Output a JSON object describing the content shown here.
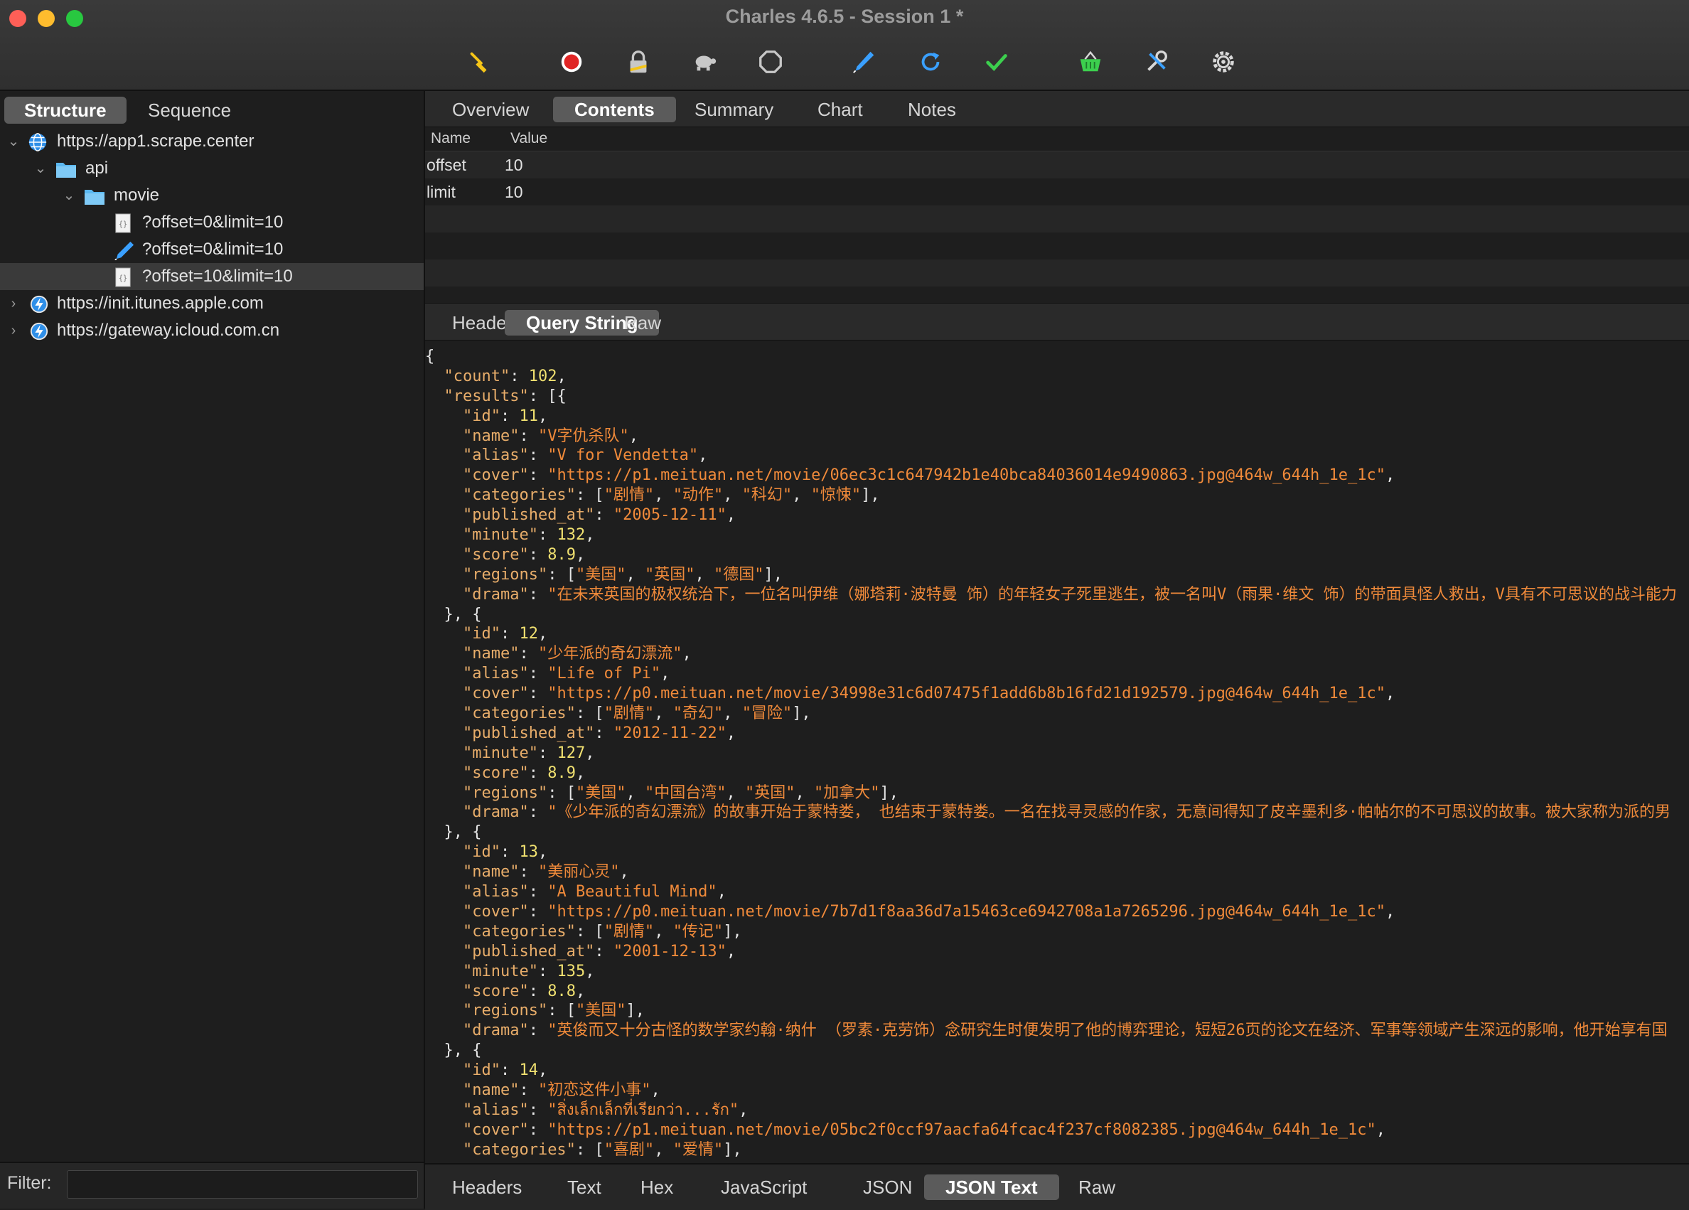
{
  "window": {
    "title": "Charles 4.6.5 - Session 1 *"
  },
  "toolbar": {
    "icons": [
      "broom-icon",
      "record-icon",
      "ssl-lock-icon",
      "throttle-turtle-icon",
      "stop-breakpoints-icon",
      "compose-pen-icon",
      "repeat-icon",
      "validate-check-icon",
      "basket-icon",
      "tools-icon",
      "settings-gear-icon"
    ],
    "colors": {
      "broom": "#f5c518",
      "record": "#e02424",
      "lock": "#c8c8c8",
      "turtle": "#c8c8c8",
      "stop": "#c8c8c8",
      "pen": "#3aa0ff",
      "repeat": "#3aa0ff",
      "check": "#3ccf4e",
      "basket": "#3ccf4e",
      "tools": "#d8d8d8",
      "gear": "#d8d8d8"
    }
  },
  "left": {
    "segments": [
      {
        "label": "Structure",
        "active": true
      },
      {
        "label": "Sequence",
        "active": false
      }
    ],
    "tree": [
      {
        "label": "https://app1.scrape.center",
        "depth": 0,
        "chevron": "down",
        "icon": "globe-icon"
      },
      {
        "label": "api",
        "depth": 1,
        "chevron": "down",
        "icon": "folder-icon"
      },
      {
        "label": "movie",
        "depth": 2,
        "chevron": "down",
        "icon": "folder-icon"
      },
      {
        "label": "?offset=0&limit=10",
        "depth": 3,
        "chevron": "",
        "icon": "json-file-icon"
      },
      {
        "label": "?offset=0&limit=10",
        "depth": 3,
        "chevron": "",
        "icon": "pen-icon"
      },
      {
        "label": "?offset=10&limit=10",
        "depth": 3,
        "chevron": "",
        "icon": "json-file-icon",
        "selected": true
      },
      {
        "label": "https://init.itunes.apple.com",
        "depth": 0,
        "chevron": "right",
        "icon": "lightning-icon"
      },
      {
        "label": "https://gateway.icloud.com.cn",
        "depth": 0,
        "chevron": "right",
        "icon": "lightning-icon"
      }
    ],
    "filter": {
      "label": "Filter:",
      "value": ""
    }
  },
  "top_tabs": [
    {
      "label": "Overview",
      "active": false
    },
    {
      "label": "Contents",
      "active": true
    },
    {
      "label": "Summary",
      "active": false
    },
    {
      "label": "Chart",
      "active": false
    },
    {
      "label": "Notes",
      "active": false
    }
  ],
  "query_table": {
    "headers": [
      "Name",
      "Value"
    ],
    "rows": [
      [
        "offset",
        "10"
      ],
      [
        "limit",
        "10"
      ],
      [
        "",
        ""
      ],
      [
        "",
        ""
      ],
      [
        "",
        ""
      ]
    ]
  },
  "request_tabs": [
    {
      "label": "Headers",
      "active": false
    },
    {
      "label": "Query String",
      "active": true
    },
    {
      "label": "Raw",
      "active": false
    }
  ],
  "json_lines": [
    [
      [
        "p",
        "{"
      ]
    ],
    [
      [
        "p",
        "  "
      ],
      [
        "k",
        "\"count\""
      ],
      [
        "p",
        ": "
      ],
      [
        "n",
        "102"
      ],
      [
        "p",
        ","
      ]
    ],
    [
      [
        "p",
        "  "
      ],
      [
        "k",
        "\"results\""
      ],
      [
        "p",
        ": [{"
      ]
    ],
    [
      [
        "p",
        "    "
      ],
      [
        "k",
        "\"id\""
      ],
      [
        "p",
        ": "
      ],
      [
        "n",
        "11"
      ],
      [
        "p",
        ","
      ]
    ],
    [
      [
        "p",
        "    "
      ],
      [
        "k",
        "\"name\""
      ],
      [
        "p",
        ": "
      ],
      [
        "s",
        "\"V字仇杀队\""
      ],
      [
        "p",
        ","
      ]
    ],
    [
      [
        "p",
        "    "
      ],
      [
        "k",
        "\"alias\""
      ],
      [
        "p",
        ": "
      ],
      [
        "s",
        "\"V for Vendetta\""
      ],
      [
        "p",
        ","
      ]
    ],
    [
      [
        "p",
        "    "
      ],
      [
        "k",
        "\"cover\""
      ],
      [
        "p",
        ": "
      ],
      [
        "s",
        "\"https://p1.meituan.net/movie/06ec3c1c647942b1e40bca84036014e9490863.jpg@464w_644h_1e_1c\""
      ],
      [
        "p",
        ","
      ]
    ],
    [
      [
        "p",
        "    "
      ],
      [
        "k",
        "\"categories\""
      ],
      [
        "p",
        ": ["
      ],
      [
        "s",
        "\"剧情\""
      ],
      [
        "p",
        ", "
      ],
      [
        "s",
        "\"动作\""
      ],
      [
        "p",
        ", "
      ],
      [
        "s",
        "\"科幻\""
      ],
      [
        "p",
        ", "
      ],
      [
        "s",
        "\"惊悚\""
      ],
      [
        "p",
        "],"
      ]
    ],
    [
      [
        "p",
        "    "
      ],
      [
        "k",
        "\"published_at\""
      ],
      [
        "p",
        ": "
      ],
      [
        "s",
        "\"2005-12-11\""
      ],
      [
        "p",
        ","
      ]
    ],
    [
      [
        "p",
        "    "
      ],
      [
        "k",
        "\"minute\""
      ],
      [
        "p",
        ": "
      ],
      [
        "n",
        "132"
      ],
      [
        "p",
        ","
      ]
    ],
    [
      [
        "p",
        "    "
      ],
      [
        "k",
        "\"score\""
      ],
      [
        "p",
        ": "
      ],
      [
        "n",
        "8.9"
      ],
      [
        "p",
        ","
      ]
    ],
    [
      [
        "p",
        "    "
      ],
      [
        "k",
        "\"regions\""
      ],
      [
        "p",
        ": ["
      ],
      [
        "s",
        "\"美国\""
      ],
      [
        "p",
        ", "
      ],
      [
        "s",
        "\"英国\""
      ],
      [
        "p",
        ", "
      ],
      [
        "s",
        "\"德国\""
      ],
      [
        "p",
        "],"
      ]
    ],
    [
      [
        "p",
        "    "
      ],
      [
        "k",
        "\"drama\""
      ],
      [
        "p",
        ": "
      ],
      [
        "s",
        "\"在未来英国的极权统治下，一位名叫伊维（娜塔莉·波特曼 饰）的年轻女子死里逃生，被一名叫V（雨果·维文 饰）的带面具怪人救出，V具有不可思议的战斗能力"
      ]
    ],
    [
      [
        "p",
        "  }, {"
      ]
    ],
    [
      [
        "p",
        "    "
      ],
      [
        "k",
        "\"id\""
      ],
      [
        "p",
        ": "
      ],
      [
        "n",
        "12"
      ],
      [
        "p",
        ","
      ]
    ],
    [
      [
        "p",
        "    "
      ],
      [
        "k",
        "\"name\""
      ],
      [
        "p",
        ": "
      ],
      [
        "s",
        "\"少年派的奇幻漂流\""
      ],
      [
        "p",
        ","
      ]
    ],
    [
      [
        "p",
        "    "
      ],
      [
        "k",
        "\"alias\""
      ],
      [
        "p",
        ": "
      ],
      [
        "s",
        "\"Life of Pi\""
      ],
      [
        "p",
        ","
      ]
    ],
    [
      [
        "p",
        "    "
      ],
      [
        "k",
        "\"cover\""
      ],
      [
        "p",
        ": "
      ],
      [
        "s",
        "\"https://p0.meituan.net/movie/34998e31c6d07475f1add6b8b16fd21d192579.jpg@464w_644h_1e_1c\""
      ],
      [
        "p",
        ","
      ]
    ],
    [
      [
        "p",
        "    "
      ],
      [
        "k",
        "\"categories\""
      ],
      [
        "p",
        ": ["
      ],
      [
        "s",
        "\"剧情\""
      ],
      [
        "p",
        ", "
      ],
      [
        "s",
        "\"奇幻\""
      ],
      [
        "p",
        ", "
      ],
      [
        "s",
        "\"冒险\""
      ],
      [
        "p",
        "],"
      ]
    ],
    [
      [
        "p",
        "    "
      ],
      [
        "k",
        "\"published_at\""
      ],
      [
        "p",
        ": "
      ],
      [
        "s",
        "\"2012-11-22\""
      ],
      [
        "p",
        ","
      ]
    ],
    [
      [
        "p",
        "    "
      ],
      [
        "k",
        "\"minute\""
      ],
      [
        "p",
        ": "
      ],
      [
        "n",
        "127"
      ],
      [
        "p",
        ","
      ]
    ],
    [
      [
        "p",
        "    "
      ],
      [
        "k",
        "\"score\""
      ],
      [
        "p",
        ": "
      ],
      [
        "n",
        "8.9"
      ],
      [
        "p",
        ","
      ]
    ],
    [
      [
        "p",
        "    "
      ],
      [
        "k",
        "\"regions\""
      ],
      [
        "p",
        ": ["
      ],
      [
        "s",
        "\"美国\""
      ],
      [
        "p",
        ", "
      ],
      [
        "s",
        "\"中国台湾\""
      ],
      [
        "p",
        ", "
      ],
      [
        "s",
        "\"英国\""
      ],
      [
        "p",
        ", "
      ],
      [
        "s",
        "\"加拿大\""
      ],
      [
        "p",
        "],"
      ]
    ],
    [
      [
        "p",
        "    "
      ],
      [
        "k",
        "\"drama\""
      ],
      [
        "p",
        ": "
      ],
      [
        "s",
        "\"《少年派的奇幻漂流》的故事开始于蒙特娄， 也结束于蒙特娄。一名在找寻灵感的作家，无意间得知了皮辛墨利多·帕帖尔的不可思议的故事。被大家称为派的男"
      ]
    ],
    [
      [
        "p",
        "  }, {"
      ]
    ],
    [
      [
        "p",
        "    "
      ],
      [
        "k",
        "\"id\""
      ],
      [
        "p",
        ": "
      ],
      [
        "n",
        "13"
      ],
      [
        "p",
        ","
      ]
    ],
    [
      [
        "p",
        "    "
      ],
      [
        "k",
        "\"name\""
      ],
      [
        "p",
        ": "
      ],
      [
        "s",
        "\"美丽心灵\""
      ],
      [
        "p",
        ","
      ]
    ],
    [
      [
        "p",
        "    "
      ],
      [
        "k",
        "\"alias\""
      ],
      [
        "p",
        ": "
      ],
      [
        "s",
        "\"A Beautiful Mind\""
      ],
      [
        "p",
        ","
      ]
    ],
    [
      [
        "p",
        "    "
      ],
      [
        "k",
        "\"cover\""
      ],
      [
        "p",
        ": "
      ],
      [
        "s",
        "\"https://p0.meituan.net/movie/7b7d1f8aa36d7a15463ce6942708a1a7265296.jpg@464w_644h_1e_1c\""
      ],
      [
        "p",
        ","
      ]
    ],
    [
      [
        "p",
        "    "
      ],
      [
        "k",
        "\"categories\""
      ],
      [
        "p",
        ": ["
      ],
      [
        "s",
        "\"剧情\""
      ],
      [
        "p",
        ", "
      ],
      [
        "s",
        "\"传记\""
      ],
      [
        "p",
        "],"
      ]
    ],
    [
      [
        "p",
        "    "
      ],
      [
        "k",
        "\"published_at\""
      ],
      [
        "p",
        ": "
      ],
      [
        "s",
        "\"2001-12-13\""
      ],
      [
        "p",
        ","
      ]
    ],
    [
      [
        "p",
        "    "
      ],
      [
        "k",
        "\"minute\""
      ],
      [
        "p",
        ": "
      ],
      [
        "n",
        "135"
      ],
      [
        "p",
        ","
      ]
    ],
    [
      [
        "p",
        "    "
      ],
      [
        "k",
        "\"score\""
      ],
      [
        "p",
        ": "
      ],
      [
        "n",
        "8.8"
      ],
      [
        "p",
        ","
      ]
    ],
    [
      [
        "p",
        "    "
      ],
      [
        "k",
        "\"regions\""
      ],
      [
        "p",
        ": ["
      ],
      [
        "s",
        "\"美国\""
      ],
      [
        "p",
        "],"
      ]
    ],
    [
      [
        "p",
        "    "
      ],
      [
        "k",
        "\"drama\""
      ],
      [
        "p",
        ": "
      ],
      [
        "s",
        "\"英俊而又十分古怪的数学家约翰·纳什 （罗素·克劳饰）念研究生时便发明了他的博弈理论，短短26页的论文在经济、军事等领域产生深远的影响，他开始享有国"
      ]
    ],
    [
      [
        "p",
        "  }, {"
      ]
    ],
    [
      [
        "p",
        "    "
      ],
      [
        "k",
        "\"id\""
      ],
      [
        "p",
        ": "
      ],
      [
        "n",
        "14"
      ],
      [
        "p",
        ","
      ]
    ],
    [
      [
        "p",
        "    "
      ],
      [
        "k",
        "\"name\""
      ],
      [
        "p",
        ": "
      ],
      [
        "s",
        "\"初恋这件小事\""
      ],
      [
        "p",
        ","
      ]
    ],
    [
      [
        "p",
        "    "
      ],
      [
        "k",
        "\"alias\""
      ],
      [
        "p",
        ": "
      ],
      [
        "s",
        "\"สิ่งเล็กเล็กที่เรียกว่า...รัก\""
      ],
      [
        "p",
        ","
      ]
    ],
    [
      [
        "p",
        "    "
      ],
      [
        "k",
        "\"cover\""
      ],
      [
        "p",
        ": "
      ],
      [
        "s",
        "\"https://p1.meituan.net/movie/05bc2f0ccf97aacfa64fcac4f237cf8082385.jpg@464w_644h_1e_1c\""
      ],
      [
        "p",
        ","
      ]
    ],
    [
      [
        "p",
        "    "
      ],
      [
        "k",
        "\"categories\""
      ],
      [
        "p",
        ": ["
      ],
      [
        "s",
        "\"喜剧\""
      ],
      [
        "p",
        ", "
      ],
      [
        "s",
        "\"爱情\""
      ],
      [
        "p",
        "],"
      ]
    ]
  ],
  "response_tabs": [
    {
      "label": "Headers",
      "active": false
    },
    {
      "label": "Text",
      "active": false
    },
    {
      "label": "Hex",
      "active": false
    },
    {
      "label": "JavaScript",
      "active": false
    },
    {
      "label": "JSON",
      "active": false
    },
    {
      "label": "JSON Text",
      "active": true
    },
    {
      "label": "Raw",
      "active": false
    }
  ]
}
